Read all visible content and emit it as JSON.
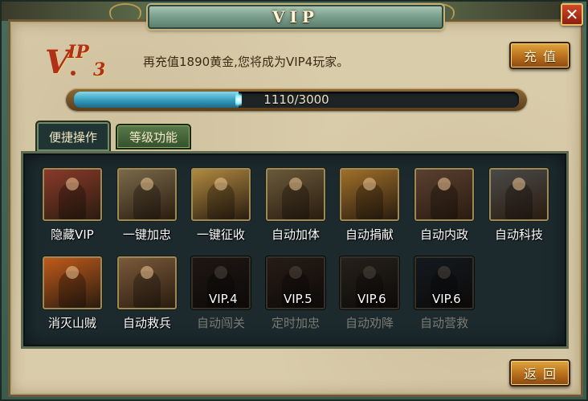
{
  "window": {
    "title": "VIP",
    "close_symbol": "✕"
  },
  "vip": {
    "badge_prefix": "V",
    "badge_suffix": "IP",
    "level": "3",
    "message": "再充值1890黄金,您将成为VIP4玩家。",
    "recharge_label": "充值",
    "progress": {
      "current": 1110,
      "max": 3000,
      "text": "1110/3000"
    }
  },
  "tabs": [
    {
      "label": "便捷操作",
      "active": true
    },
    {
      "label": "等级功能",
      "active": false
    }
  ],
  "features": [
    {
      "label": "隐藏VIP",
      "locked": false,
      "vip_required": "",
      "icon": "twin-generals-icon",
      "color": "#8a3a2a"
    },
    {
      "label": "一键加忠",
      "locked": false,
      "vip_required": "",
      "icon": "scholar-icon",
      "color": "#7a6a4a"
    },
    {
      "label": "一键征收",
      "locked": false,
      "vip_required": "",
      "icon": "farmer-icon",
      "color": "#b08a40"
    },
    {
      "label": "自动加体",
      "locked": false,
      "vip_required": "",
      "icon": "warrior-icon",
      "color": "#6a5a3a"
    },
    {
      "label": "自动捐献",
      "locked": false,
      "vip_required": "",
      "icon": "spearman-icon",
      "color": "#a0702a"
    },
    {
      "label": "自动内政",
      "locked": false,
      "vip_required": "",
      "icon": "official-icon",
      "color": "#5a4030"
    },
    {
      "label": "自动科技",
      "locked": false,
      "vip_required": "",
      "icon": "library-icon",
      "color": "#4a4a48"
    },
    {
      "label": "消灭山贼",
      "locked": false,
      "vip_required": "",
      "icon": "banner-sunset-icon",
      "color": "#c05a1a"
    },
    {
      "label": "自动救兵",
      "locked": false,
      "vip_required": "",
      "icon": "camp-icon",
      "color": "#7a5a3a"
    },
    {
      "label": "自动闯关",
      "locked": true,
      "vip_required": "VIP.4",
      "icon": "battle-icon",
      "color": "#6a3a2a"
    },
    {
      "label": "定时加忠",
      "locked": true,
      "vip_required": "VIP.5",
      "icon": "throne-icon",
      "color": "#8a4a2a"
    },
    {
      "label": "自动劝降",
      "locked": true,
      "vip_required": "VIP.6",
      "icon": "banquet-icon",
      "color": "#7a5a3a"
    },
    {
      "label": "自动营救",
      "locked": true,
      "vip_required": "VIP.6",
      "icon": "night-raid-icon",
      "color": "#2a4a6a"
    }
  ],
  "footer": {
    "back_label": "返回"
  }
}
